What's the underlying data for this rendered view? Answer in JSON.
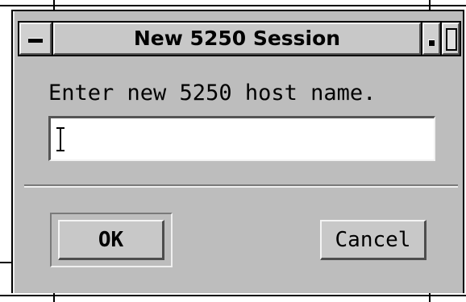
{
  "window": {
    "title": "New 5250 Session"
  },
  "dialog": {
    "prompt": "Enter new 5250 host name.",
    "host_input_value": ""
  },
  "buttons": {
    "ok_label": "OK",
    "cancel_label": "Cancel"
  },
  "icons": {
    "window_menu": "window-menu-icon",
    "minimize": "minimize-icon",
    "maximize": "maximize-icon",
    "text_cursor": "text-cursor-icon"
  },
  "colors": {
    "dialog_background": "#bdbdbd",
    "input_background": "#ffffff",
    "text": "#000000"
  }
}
